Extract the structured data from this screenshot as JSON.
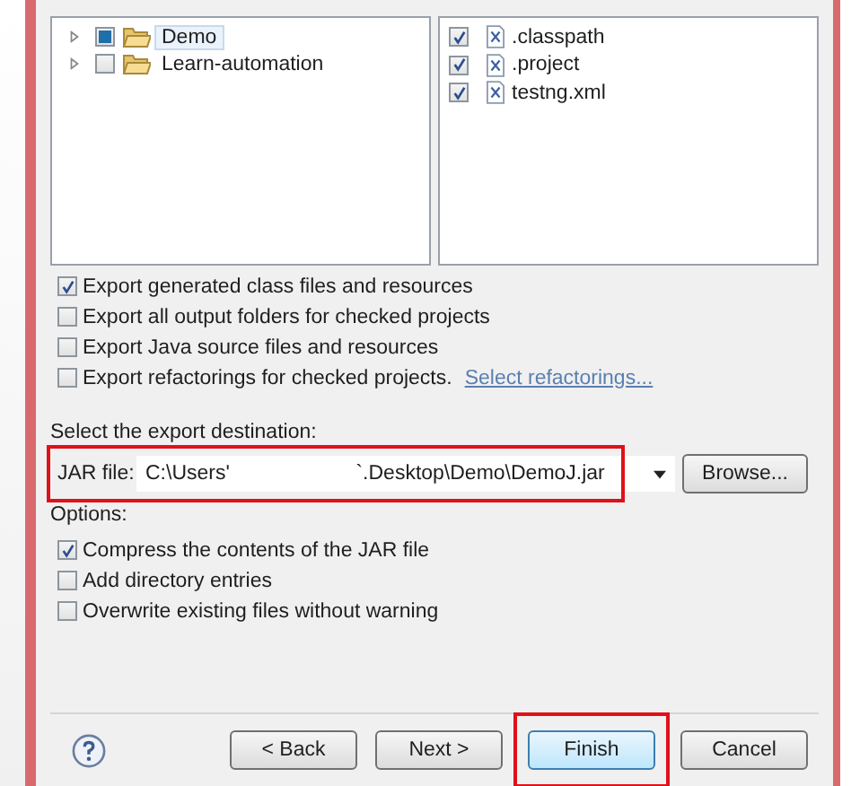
{
  "resources": {
    "projects": [
      {
        "label": "Demo",
        "partial": true,
        "selected": true,
        "expanded": false
      },
      {
        "label": "Learn-automation",
        "partial": false,
        "selected": false,
        "expanded": false
      }
    ],
    "files": [
      {
        "label": ".classpath",
        "checked": true
      },
      {
        "label": ".project",
        "checked": true
      },
      {
        "label": "testng.xml",
        "checked": true
      }
    ]
  },
  "export_options": [
    {
      "label": "Export generated class files and resources",
      "checked": true
    },
    {
      "label": "Export all output folders for checked projects",
      "checked": false
    },
    {
      "label": "Export Java source files and resources",
      "checked": false
    },
    {
      "label": "Export refactorings for checked projects.",
      "checked": false,
      "link": "Select refactorings..."
    }
  ],
  "destination": {
    "heading": "Select the export destination:",
    "label": "JAR file:",
    "value": "C:\\Users'                      `.Desktop\\Demo\\DemoJ.jar",
    "button": "Browse...",
    "highlighted": true
  },
  "options": {
    "heading": "Options:",
    "items": [
      {
        "label": "Compress the contents of the JAR file",
        "checked": true
      },
      {
        "label": "Add directory entries",
        "checked": false
      },
      {
        "label": "Overwrite existing files without warning",
        "checked": false
      }
    ]
  },
  "buttons": [
    {
      "label": "< Back",
      "highlighted": false,
      "focused": false
    },
    {
      "label": "Next >",
      "highlighted": false,
      "focused": false
    },
    {
      "label": "Finish",
      "highlighted": true,
      "focused": true
    },
    {
      "label": "Cancel",
      "highlighted": false,
      "focused": false
    }
  ]
}
